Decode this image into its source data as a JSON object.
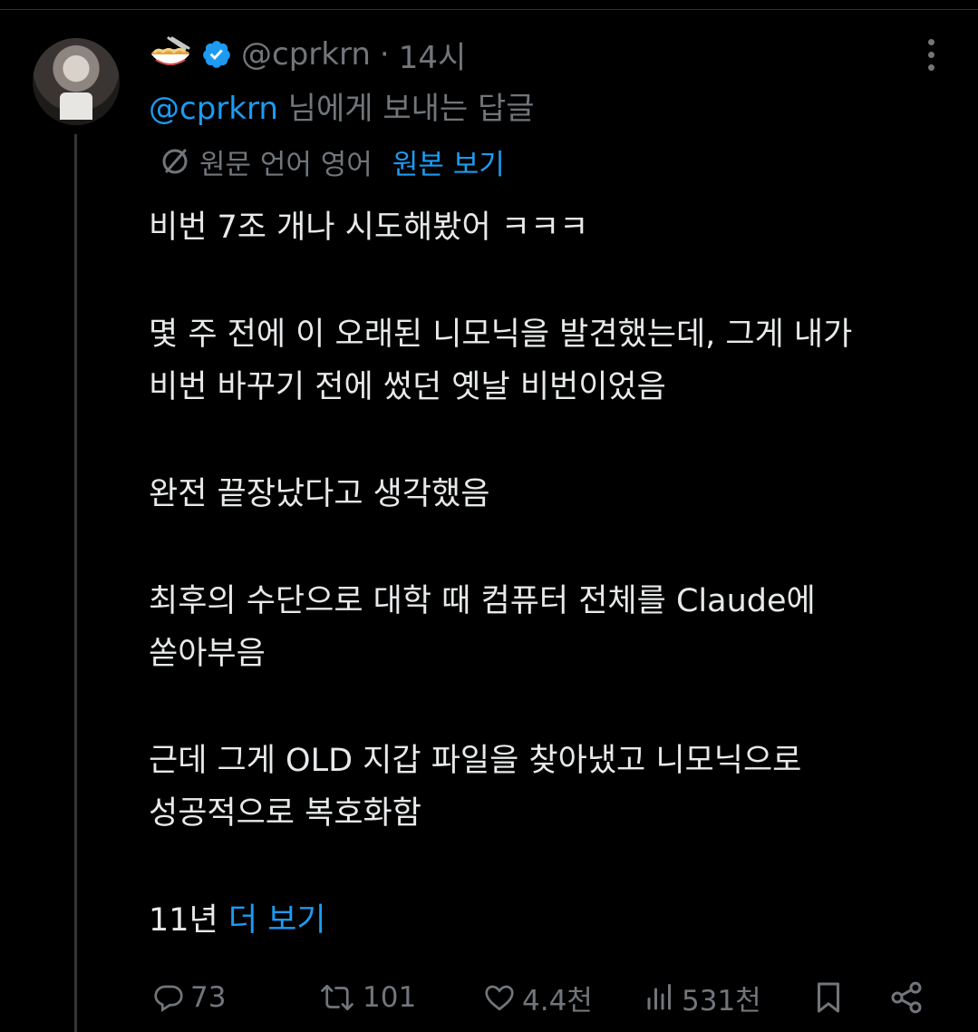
{
  "header": {
    "handle": "@cprkrn",
    "separator": "·",
    "time": "14시"
  },
  "reply_context": {
    "mention": "@cprkrn",
    "suffix": " 님에게 보내는 답글"
  },
  "translation": {
    "label": "원문 언어 영어",
    "link": "원본 보기"
  },
  "tweet": {
    "paragraphs": [
      "비번 7조 개나 시도해봤어 ㅋㅋㅋ",
      "몇 주 전에 이 오래된 니모닉을 발견했는데, 그게 내가\n비번 바꾸기 전에 썼던 옛날 비번이었음",
      "완전 끝장났다고 생각했음",
      "최후의 수단으로 대학 때 컴퓨터 전체를 Claude에\n쏟아부음",
      "근데 그게 OLD 지갑 파일을 찾아냈고 니모닉으로\n성공적으로 복호화함"
    ],
    "last_line_text": "11년 ",
    "show_more": "더 보기"
  },
  "actions": {
    "replies": "73",
    "retweets": "101",
    "likes": "4.4천",
    "views": "531천"
  },
  "icons": {
    "reply": "reply-icon",
    "retweet": "retweet-icon",
    "like": "heart-icon",
    "views": "views-icon",
    "bookmark": "bookmark-icon",
    "share": "share-icon",
    "more": "more-icon",
    "verified": "verified-badge-icon",
    "translate": "translate-icon"
  },
  "colors": {
    "background": "#000000",
    "text": "#e7e9ea",
    "secondary": "#71767b",
    "accent": "#1d9bf0"
  }
}
